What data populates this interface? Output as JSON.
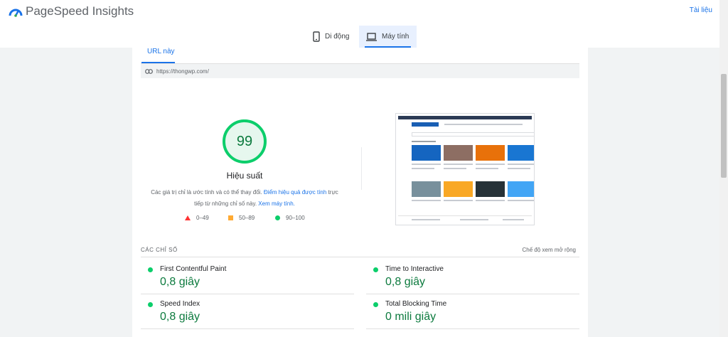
{
  "header": {
    "app_name": "PageSpeed Insights",
    "docs_label": "Tài liệu"
  },
  "device_tabs": {
    "mobile_label": "Di động",
    "desktop_label": "Máy tính",
    "selected": "desktop"
  },
  "url_section": {
    "tab_label": "URL này",
    "url": "https://thongwp.com/"
  },
  "performance": {
    "score": "99",
    "score_value": 99,
    "label": "Hiệu suất",
    "desc_part1": "Các giá trị chỉ là ước tính và có thể thay đổi. ",
    "desc_link1": "Điểm hiệu quả được tính",
    "desc_part2": " trực tiếp từ những chỉ số này. ",
    "desc_link2": "Xem máy tính.",
    "legend": [
      {
        "range": "0–49",
        "shape": "triangle",
        "color": "#ff3333"
      },
      {
        "range": "50–89",
        "shape": "square",
        "color": "#ffaa33"
      },
      {
        "range": "90–100",
        "shape": "circle",
        "color": "#0cce6b"
      }
    ]
  },
  "metrics": {
    "title": "CÁC CHỈ SỐ",
    "expand_label": "Chế độ xem mở rộng",
    "items": [
      {
        "name": "First Contentful Paint",
        "value": "0,8 giây"
      },
      {
        "name": "Time to Interactive",
        "value": "0,8 giây"
      },
      {
        "name": "Speed Index",
        "value": "0,8 giây"
      },
      {
        "name": "Total Blocking Time",
        "value": "0 mili giây"
      }
    ]
  },
  "colors": {
    "accent": "#1a73e8",
    "pass": "#0cce6b",
    "pass_text": "#0c7a3e"
  }
}
